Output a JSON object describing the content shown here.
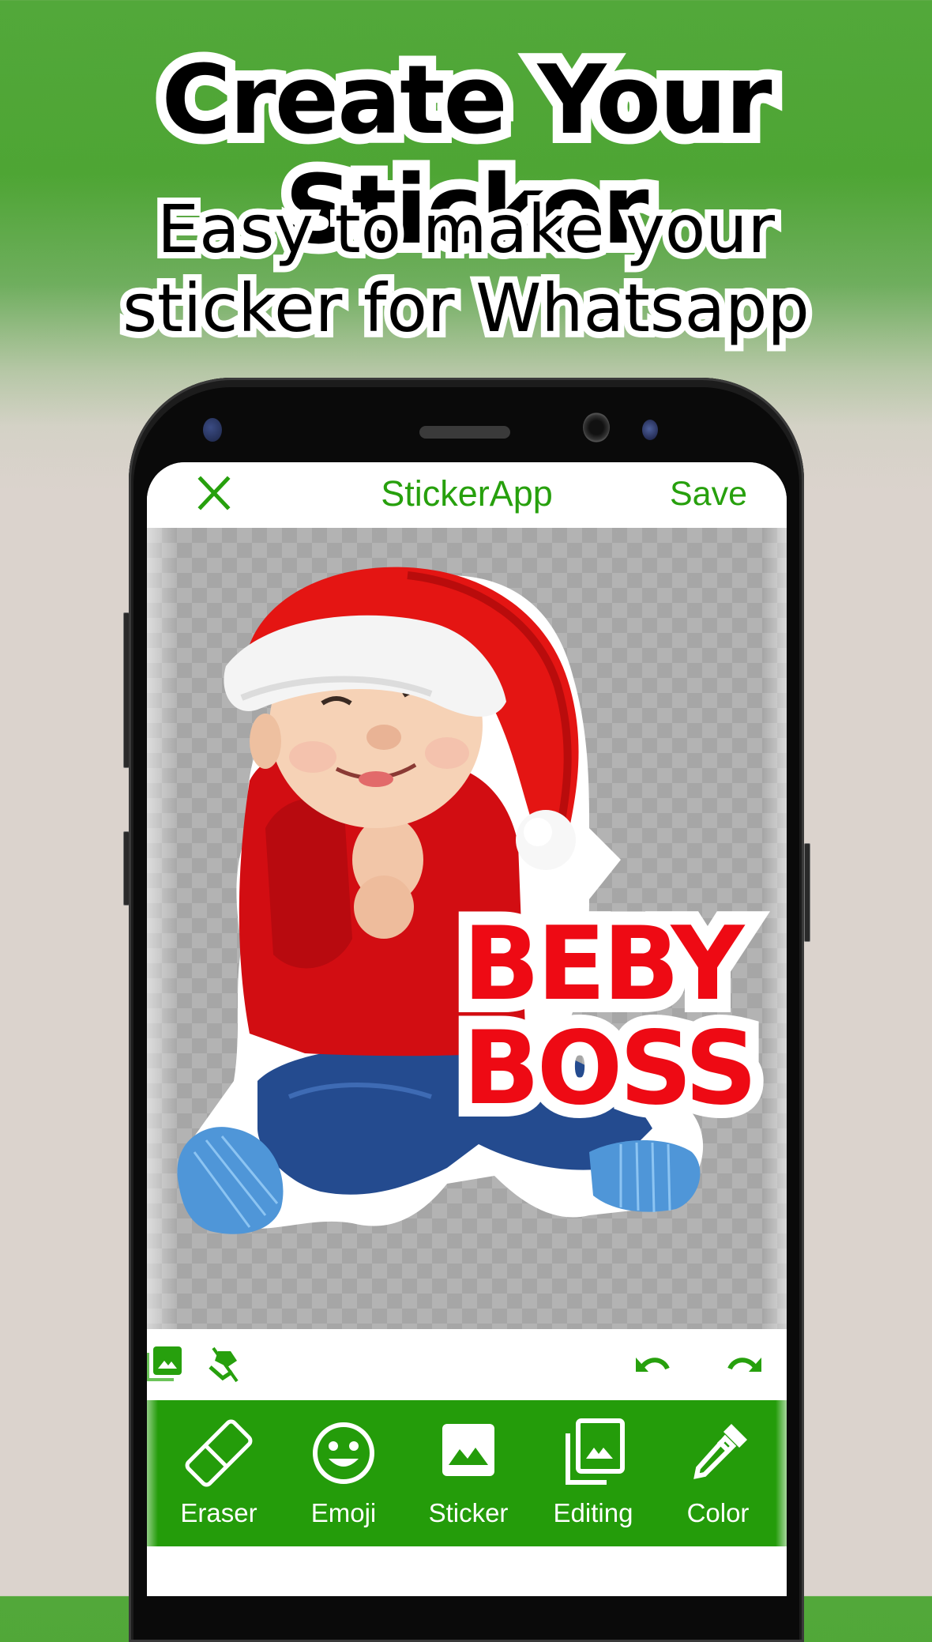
{
  "promo": {
    "title": "Create Your Sticker",
    "subtitle_lines": [
      "Easy to make your",
      "sticker for Whatsapp"
    ]
  },
  "app": {
    "title": "StickerApp",
    "close_icon": "close-icon",
    "save_label": "Save",
    "accent_color": "#27a00d",
    "bottom_bar_color": "#249c0a"
  },
  "canvas": {
    "background": "transparent-checkerboard",
    "sticker_subject": "baby in red santa hat, red sweater and blue jeans",
    "sticker_text_lines": [
      "BEBY",
      "BOSS"
    ],
    "sticker_text_color": "#ee0a14"
  },
  "toolrow": {
    "left": [
      {
        "icon": "gallery-icon",
        "name": "gallery"
      },
      {
        "icon": "layers-off-icon",
        "name": "layers-off"
      }
    ],
    "right": [
      {
        "icon": "undo-icon",
        "name": "undo"
      },
      {
        "icon": "redo-icon",
        "name": "redo"
      }
    ]
  },
  "bottom_tools": [
    {
      "label": "Eraser",
      "icon": "eraser-icon"
    },
    {
      "label": "Emoji",
      "icon": "emoji-icon"
    },
    {
      "label": "Sticker",
      "icon": "image-icon"
    },
    {
      "label": "Editing",
      "icon": "photo-library-icon"
    },
    {
      "label": "Color",
      "icon": "color-picker-icon"
    }
  ]
}
